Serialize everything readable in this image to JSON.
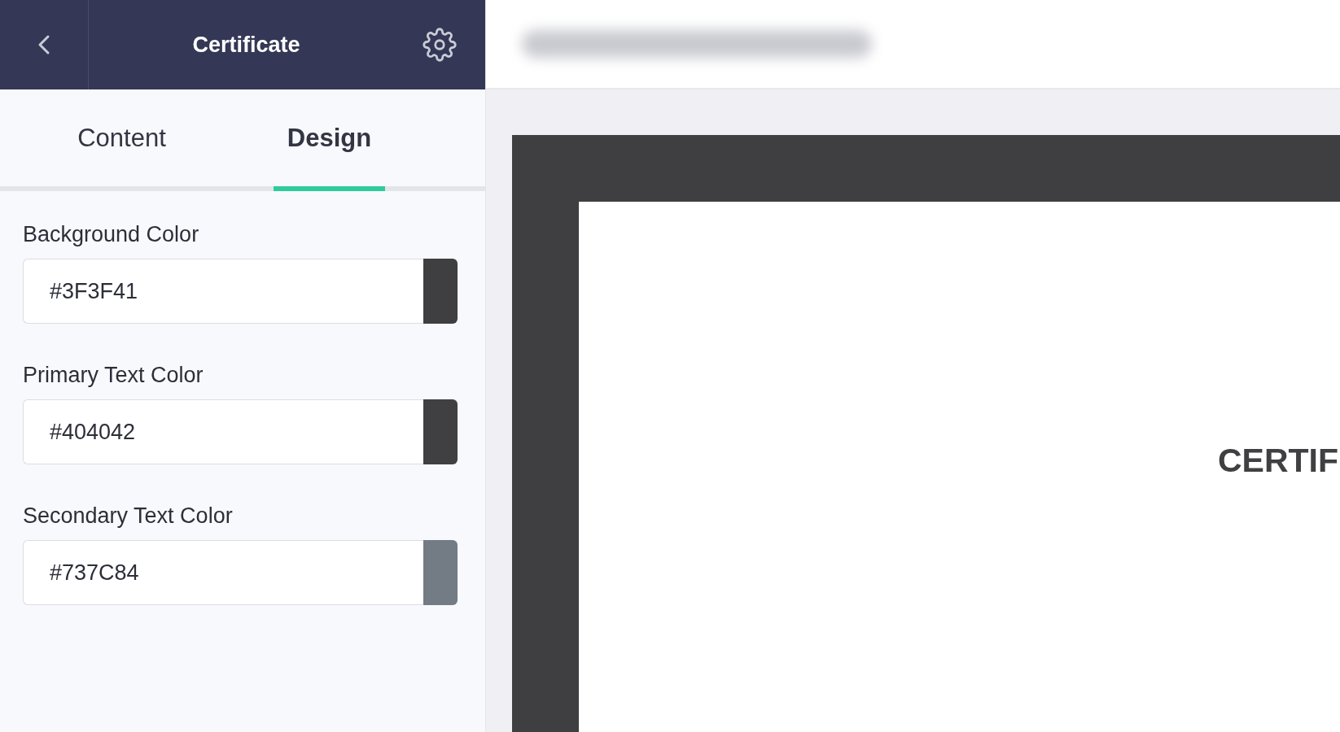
{
  "header": {
    "title": "Certificate"
  },
  "tabs": [
    {
      "label": "Content",
      "selected": false
    },
    {
      "label": "Design",
      "selected": true
    }
  ],
  "fields": [
    {
      "label": "Background Color",
      "value": "#3F3F41",
      "color": "#3f3f41"
    },
    {
      "label": "Primary Text Color",
      "value": "#404042",
      "color": "#404042"
    },
    {
      "label": "Secondary Text Color",
      "value": "#737C84",
      "color": "#737c84"
    }
  ],
  "preview": {
    "heading": "CERTIF"
  }
}
